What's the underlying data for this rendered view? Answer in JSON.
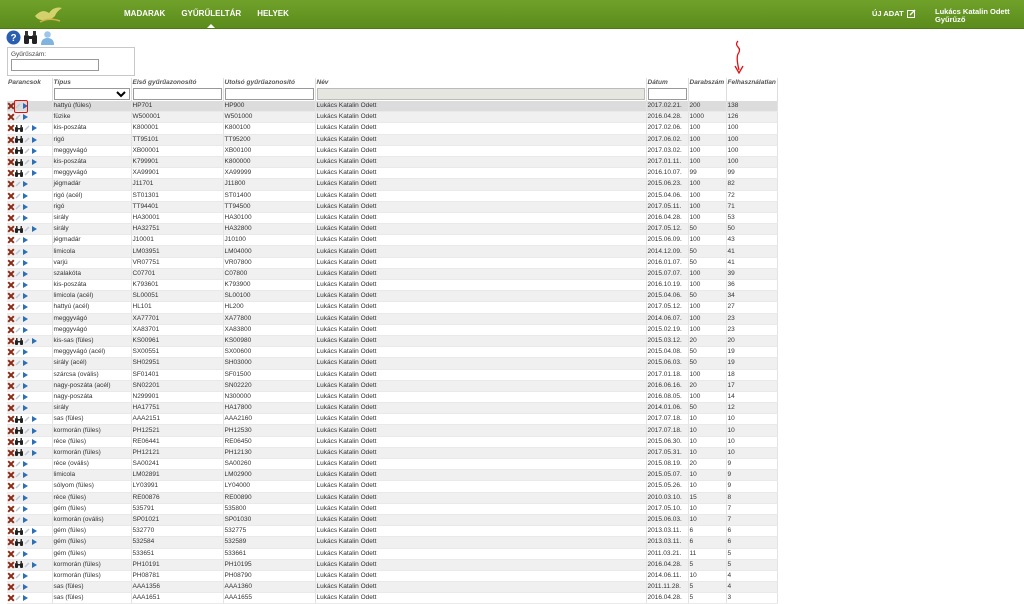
{
  "nav": {
    "items": [
      "MADARAK",
      "GYŰRŰLELTÁR",
      "HELYEK"
    ],
    "active_index": 1
  },
  "header": {
    "new_data_label": "ÚJ ADAT",
    "user_line1": "Lukács Katalin Odett",
    "user_line2": "Gyűrűző"
  },
  "toolbar": {
    "icons": [
      "help-icon",
      "binoculars-icon",
      "user-icon"
    ]
  },
  "filter": {
    "ring_label": "Gyűrűszám:",
    "ring_value": ""
  },
  "table": {
    "columns": [
      "Parancsok",
      "Típus",
      "Első gyűrűazonosító",
      "Utolsó gyűrűazonosító",
      "Név",
      "Dátum",
      "Darabszám",
      "Felhasználatlan"
    ],
    "rows": [
      {
        "icons": "xpp",
        "tipus": "hattyú (füles)",
        "elso": "HP701",
        "utolso": "HP900",
        "nev": "Lukács Katalin Odett",
        "datum": "2017.02.21.",
        "db": "200",
        "felh": "138"
      },
      {
        "icons": "xpp",
        "tipus": "füzike",
        "elso": "W500001",
        "utolso": "W501000",
        "nev": "Lukács Katalin Odett",
        "datum": "2016.04.28.",
        "db": "1000",
        "felh": "126"
      },
      {
        "icons": "xbpp",
        "tipus": "kis-poszáta",
        "elso": "K800001",
        "utolso": "K800100",
        "nev": "Lukács Katalin Odett",
        "datum": "2017.02.06.",
        "db": "100",
        "felh": "100"
      },
      {
        "icons": "xbpp",
        "tipus": "rigó",
        "elso": "TT95101",
        "utolso": "TT95200",
        "nev": "Lukács Katalin Odett",
        "datum": "2017.06.02.",
        "db": "100",
        "felh": "100"
      },
      {
        "icons": "xbpp",
        "tipus": "meggyvágó",
        "elso": "XB00001",
        "utolso": "XB00100",
        "nev": "Lukács Katalin Odett",
        "datum": "2017.03.02.",
        "db": "100",
        "felh": "100"
      },
      {
        "icons": "xbpp",
        "tipus": "kis-poszáta",
        "elso": "K799901",
        "utolso": "K800000",
        "nev": "Lukács Katalin Odett",
        "datum": "2017.01.11.",
        "db": "100",
        "felh": "100"
      },
      {
        "icons": "xbpp",
        "tipus": "meggyvágó",
        "elso": "XA99901",
        "utolso": "XA99999",
        "nev": "Lukács Katalin Odett",
        "datum": "2016.10.07.",
        "db": "99",
        "felh": "99"
      },
      {
        "icons": "xpp",
        "tipus": "jégmadár",
        "elso": "J11701",
        "utolso": "J11800",
        "nev": "Lukács Katalin Odett",
        "datum": "2015.06.23.",
        "db": "100",
        "felh": "82"
      },
      {
        "icons": "xpp",
        "tipus": "rigó (acél)",
        "elso": "ST01301",
        "utolso": "ST01400",
        "nev": "Lukács Katalin Odett",
        "datum": "2015.04.06.",
        "db": "100",
        "felh": "72"
      },
      {
        "icons": "xpp",
        "tipus": "rigó",
        "elso": "TT94401",
        "utolso": "TT94500",
        "nev": "Lukács Katalin Odett",
        "datum": "2017.05.11.",
        "db": "100",
        "felh": "71"
      },
      {
        "icons": "xpp",
        "tipus": "sirály",
        "elso": "HA30001",
        "utolso": "HA30100",
        "nev": "Lukács Katalin Odett",
        "datum": "2016.04.28.",
        "db": "100",
        "felh": "53"
      },
      {
        "icons": "xbpp",
        "tipus": "sirály",
        "elso": "HA32751",
        "utolso": "HA32800",
        "nev": "Lukács Katalin Odett",
        "datum": "2017.05.12.",
        "db": "50",
        "felh": "50"
      },
      {
        "icons": "xpp",
        "tipus": "jégmadár",
        "elso": "J10001",
        "utolso": "J10100",
        "nev": "Lukács Katalin Odett",
        "datum": "2015.06.09.",
        "db": "100",
        "felh": "43"
      },
      {
        "icons": "xpp",
        "tipus": "limicola",
        "elso": "LM03951",
        "utolso": "LM04000",
        "nev": "Lukács Katalin Odett",
        "datum": "2014.12.09.",
        "db": "50",
        "felh": "41"
      },
      {
        "icons": "xpp",
        "tipus": "varjú",
        "elso": "VR07751",
        "utolso": "VR07800",
        "nev": "Lukács Katalin Odett",
        "datum": "2016.01.07.",
        "db": "50",
        "felh": "41"
      },
      {
        "icons": "xpp",
        "tipus": "szalakóta",
        "elso": "C07701",
        "utolso": "C07800",
        "nev": "Lukács Katalin Odett",
        "datum": "2015.07.07.",
        "db": "100",
        "felh": "39"
      },
      {
        "icons": "xpp",
        "tipus": "kis-poszáta",
        "elso": "K793601",
        "utolso": "K793900",
        "nev": "Lukács Katalin Odett",
        "datum": "2016.10.19.",
        "db": "100",
        "felh": "36"
      },
      {
        "icons": "xpp",
        "tipus": "limicola (acél)",
        "elso": "SL00051",
        "utolso": "SL00100",
        "nev": "Lukács Katalin Odett",
        "datum": "2015.04.06.",
        "db": "50",
        "felh": "34"
      },
      {
        "icons": "xpp",
        "tipus": "hattyú (acél)",
        "elso": "HL101",
        "utolso": "HL200",
        "nev": "Lukács Katalin Odett",
        "datum": "2017.05.12.",
        "db": "100",
        "felh": "27"
      },
      {
        "icons": "xpp",
        "tipus": "meggyvágó",
        "elso": "XA77701",
        "utolso": "XA77800",
        "nev": "Lukács Katalin Odett",
        "datum": "2014.06.07.",
        "db": "100",
        "felh": "23"
      },
      {
        "icons": "xpp",
        "tipus": "meggyvágó",
        "elso": "XA83701",
        "utolso": "XA83800",
        "nev": "Lukács Katalin Odett",
        "datum": "2015.02.19.",
        "db": "100",
        "felh": "23"
      },
      {
        "icons": "xbpp",
        "tipus": "kis-sas (füles)",
        "elso": "KS00961",
        "utolso": "KS00980",
        "nev": "Lukács Katalin Odett",
        "datum": "2015.03.12.",
        "db": "20",
        "felh": "20"
      },
      {
        "icons": "xpp",
        "tipus": "meggyvágó (acél)",
        "elso": "SX00551",
        "utolso": "SX00600",
        "nev": "Lukács Katalin Odett",
        "datum": "2015.04.08.",
        "db": "50",
        "felh": "19"
      },
      {
        "icons": "xpp",
        "tipus": "sirály (acél)",
        "elso": "SH02951",
        "utolso": "SH03000",
        "nev": "Lukács Katalin Odett",
        "datum": "2015.06.03.",
        "db": "50",
        "felh": "19"
      },
      {
        "icons": "xpp",
        "tipus": "szárcsa (ovális)",
        "elso": "SF01401",
        "utolso": "SF01500",
        "nev": "Lukács Katalin Odett",
        "datum": "2017.01.18.",
        "db": "100",
        "felh": "18"
      },
      {
        "icons": "xpp",
        "tipus": "nagy-poszáta (acél)",
        "elso": "SN02201",
        "utolso": "SN02220",
        "nev": "Lukács Katalin Odett",
        "datum": "2016.06.16.",
        "db": "20",
        "felh": "17"
      },
      {
        "icons": "xpp",
        "tipus": "nagy-poszáta",
        "elso": "N299901",
        "utolso": "N300000",
        "nev": "Lukács Katalin Odett",
        "datum": "2016.08.05.",
        "db": "100",
        "felh": "14"
      },
      {
        "icons": "xpp",
        "tipus": "sirály",
        "elso": "HA17751",
        "utolso": "HA17800",
        "nev": "Lukács Katalin Odett",
        "datum": "2014.01.06.",
        "db": "50",
        "felh": "12"
      },
      {
        "icons": "xbpp",
        "tipus": "sas (füles)",
        "elso": "AAA2151",
        "utolso": "AAA2160",
        "nev": "Lukács Katalin Odett",
        "datum": "2017.07.18.",
        "db": "10",
        "felh": "10"
      },
      {
        "icons": "xbpp",
        "tipus": "kormorán (füles)",
        "elso": "PH12521",
        "utolso": "PH12530",
        "nev": "Lukács Katalin Odett",
        "datum": "2017.07.18.",
        "db": "10",
        "felh": "10"
      },
      {
        "icons": "xbpp",
        "tipus": "réce (füles)",
        "elso": "RE06441",
        "utolso": "RE06450",
        "nev": "Lukács Katalin Odett",
        "datum": "2015.06.30.",
        "db": "10",
        "felh": "10"
      },
      {
        "icons": "xbpp",
        "tipus": "kormorán (füles)",
        "elso": "PH12121",
        "utolso": "PH12130",
        "nev": "Lukács Katalin Odett",
        "datum": "2017.05.31.",
        "db": "10",
        "felh": "10"
      },
      {
        "icons": "xpp",
        "tipus": "réce (ovális)",
        "elso": "SA00241",
        "utolso": "SA00260",
        "nev": "Lukács Katalin Odett",
        "datum": "2015.08.19.",
        "db": "20",
        "felh": "9"
      },
      {
        "icons": "xpp",
        "tipus": "limicola",
        "elso": "LM02891",
        "utolso": "LM02900",
        "nev": "Lukács Katalin Odett",
        "datum": "2015.05.07.",
        "db": "10",
        "felh": "9"
      },
      {
        "icons": "xpp",
        "tipus": "sólyom (füles)",
        "elso": "LY03991",
        "utolso": "LY04000",
        "nev": "Lukács Katalin Odett",
        "datum": "2015.05.26.",
        "db": "10",
        "felh": "9"
      },
      {
        "icons": "xpp",
        "tipus": "réce (füles)",
        "elso": "RE00876",
        "utolso": "RE00890",
        "nev": "Lukács Katalin Odett",
        "datum": "2010.03.10.",
        "db": "15",
        "felh": "8"
      },
      {
        "icons": "xpp",
        "tipus": "gém (füles)",
        "elso": "535791",
        "utolso": "535800",
        "nev": "Lukács Katalin Odett",
        "datum": "2017.05.10.",
        "db": "10",
        "felh": "7"
      },
      {
        "icons": "xpp",
        "tipus": "kormorán (ovális)",
        "elso": "SP01021",
        "utolso": "SP01030",
        "nev": "Lukács Katalin Odett",
        "datum": "2015.06.03.",
        "db": "10",
        "felh": "7"
      },
      {
        "icons": "xbpp",
        "tipus": "gém (füles)",
        "elso": "532770",
        "utolso": "532775",
        "nev": "Lukács Katalin Odett",
        "datum": "2013.03.11.",
        "db": "6",
        "felh": "6"
      },
      {
        "icons": "xbpp",
        "tipus": "gém (füles)",
        "elso": "532584",
        "utolso": "532589",
        "nev": "Lukács Katalin Odett",
        "datum": "2013.03.11.",
        "db": "6",
        "felh": "6"
      },
      {
        "icons": "xpp",
        "tipus": "gém (füles)",
        "elso": "533651",
        "utolso": "533661",
        "nev": "Lukács Katalin Odett",
        "datum": "2011.03.21.",
        "db": "11",
        "felh": "5"
      },
      {
        "icons": "xbpp",
        "tipus": "kormorán (füles)",
        "elso": "PH10191",
        "utolso": "PH10195",
        "nev": "Lukács Katalin Odett",
        "datum": "2016.04.28.",
        "db": "5",
        "felh": "5"
      },
      {
        "icons": "xpp",
        "tipus": "kormorán (füles)",
        "elso": "PH08781",
        "utolso": "PH08790",
        "nev": "Lukács Katalin Odett",
        "datum": "2014.06.11.",
        "db": "10",
        "felh": "4"
      },
      {
        "icons": "xpp",
        "tipus": "sas (füles)",
        "elso": "AAA1356",
        "utolso": "AAA1360",
        "nev": "Lukács Katalin Odett",
        "datum": "2011.11.28.",
        "db": "5",
        "felh": "4"
      },
      {
        "icons": "xpp",
        "tipus": "sas (füles)",
        "elso": "AAA1651",
        "utolso": "AAA1655",
        "nev": "Lukács Katalin Odett",
        "datum": "2016.04.28.",
        "db": "5",
        "felh": "3"
      }
    ]
  },
  "colors": {
    "header_green": "#5e8f1f",
    "annotation_red": "#e01010",
    "play_blue": "#2a6fb8"
  }
}
